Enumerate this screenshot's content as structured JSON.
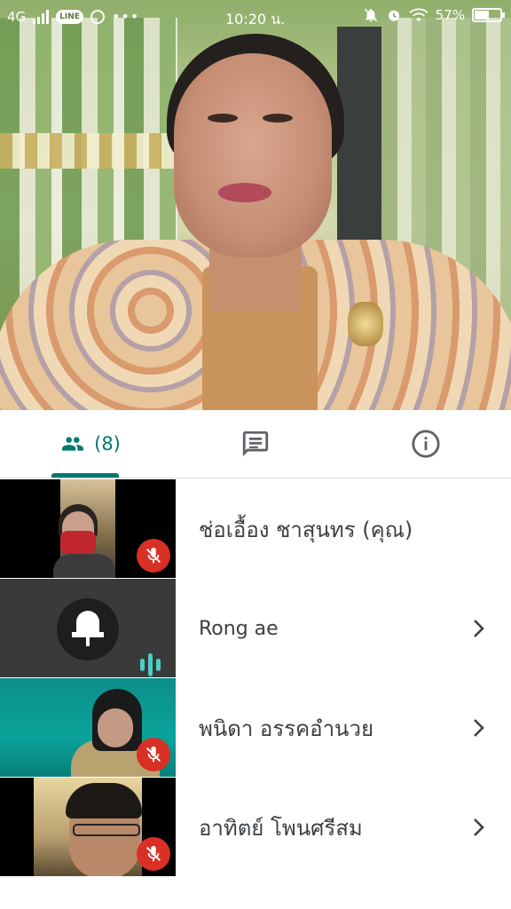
{
  "status_bar": {
    "network": "4G",
    "time": "10:20 น.",
    "battery_percent": "57%",
    "battery_level": 0.57,
    "icons": [
      "signal-icon",
      "line-app-icon",
      "chrome-icon",
      "more-dots-icon",
      "notifications-off-icon",
      "alarm-icon",
      "wifi-icon",
      "battery-charging-icon"
    ]
  },
  "tabs": {
    "people_count": "(8)",
    "icons": [
      "people-icon",
      "chat-icon",
      "info-icon"
    ],
    "active": "people"
  },
  "participants": [
    {
      "name": "ช่อเอื้อง ชาสุนทร (คุณ)",
      "muted": true,
      "has_chevron": false
    },
    {
      "name": "Rong ae",
      "muted": false,
      "speaking": true,
      "has_chevron": true
    },
    {
      "name": "พนิดา อรรคอำนวย",
      "muted": true,
      "has_chevron": true
    },
    {
      "name": "อาทิตย์ โพนศรีสม",
      "muted": true,
      "has_chevron": true
    }
  ],
  "colors": {
    "accent": "#00796b",
    "mute_red": "#d93025",
    "speaking_teal": "#4ecdc4",
    "text": "#3c4043"
  }
}
